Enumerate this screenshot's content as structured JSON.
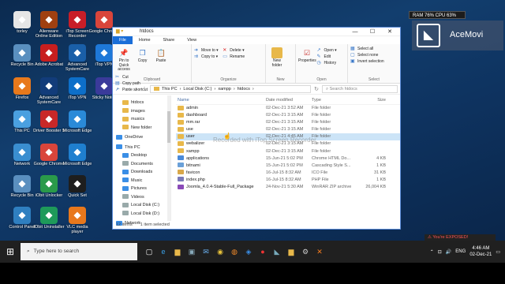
{
  "desktop": {
    "icons": [
      {
        "label": "torley",
        "icon": "user-avatar-icon",
        "color": "#e6e6e6"
      },
      {
        "label": "Alienware Online Edition",
        "icon": "alienware-icon",
        "color": "#a04010"
      },
      {
        "label": "iTop Screen Recorder",
        "icon": "screen-recorder-icon",
        "color": "#c81e28"
      },
      {
        "label": "Google Chrome",
        "icon": "chrome-icon",
        "color": "#d9453b"
      },
      {
        "label": "Recycle Bin",
        "icon": "recycle-bin-icon",
        "color": "#5a8fbf"
      },
      {
        "label": "Adobe Acrobat",
        "icon": "acrobat-icon",
        "color": "#c81e1e"
      },
      {
        "label": "Advanced SystemCare",
        "icon": "systemcare-icon",
        "color": "#1a5fa8"
      },
      {
        "label": "iTop VPN",
        "icon": "vpn-icon",
        "color": "#1e78d8"
      },
      {
        "label": "Firefox",
        "icon": "firefox-icon",
        "color": "#e8791c"
      },
      {
        "label": "Advanced SystemCare",
        "icon": "systemcare-icon",
        "color": "#123c7a"
      },
      {
        "label": "iTop VPN",
        "icon": "vpn-icon",
        "color": "#0d6fc9"
      },
      {
        "label": "Sticky Notes",
        "icon": "sticky-notes-icon",
        "color": "#3a3a9a"
      },
      {
        "label": "This PC",
        "icon": "this-pc-icon",
        "color": "#4aa0e0"
      },
      {
        "label": "Driver Booster 9",
        "icon": "driver-booster-icon",
        "color": "#c82828"
      },
      {
        "label": "Microsoft Edge",
        "icon": "edge-icon",
        "color": "#2a8ad8"
      },
      {
        "label": "Network",
        "icon": "network-icon",
        "color": "#3a8ed0"
      },
      {
        "label": "Google Chrome",
        "icon": "chrome-icon",
        "color": "#d9453b"
      },
      {
        "label": "Microsoft Edge",
        "icon": "edge-icon",
        "color": "#1f7fcf"
      },
      {
        "label": "Recycle Bin",
        "icon": "recycle-bin-icon",
        "color": "#5a8fbf"
      },
      {
        "label": "iObit Unlocker",
        "icon": "unlocker-icon",
        "color": "#2a9a4a"
      },
      {
        "label": "Quick Set",
        "icon": "quick-set-icon",
        "color": "#1e1e1e"
      },
      {
        "label": "Control Panel",
        "icon": "control-panel-icon",
        "color": "#2f7fc0"
      },
      {
        "label": "IObit Uninstaller",
        "icon": "uninstaller-icon",
        "color": "#1e9a5a"
      },
      {
        "label": "VLC media player",
        "icon": "vlc-icon",
        "color": "#e8781c"
      }
    ],
    "perf": "RAM 76%   CPU 63%",
    "acemovi": "AceMovi",
    "exposed": "You're EXPOSED!",
    "watermark": "Recorded with iTop Screen Recorder"
  },
  "explorer": {
    "title": "htdocs",
    "tabs": [
      "File",
      "Home",
      "Share",
      "View"
    ],
    "ribbon": {
      "clipboard": {
        "pin": "Pin to Quick access",
        "copy": "Copy",
        "paste": "Paste",
        "cut": "Cut",
        "copy_path": "Copy path",
        "paste_shortcut": "Paste shortcut",
        "name": "Clipboard"
      },
      "organize": {
        "move_to": "Move to",
        "copy_to": "Copy to",
        "delete": "Delete",
        "rename": "Rename",
        "name": "Organize"
      },
      "new": {
        "new_folder": "New folder",
        "name": "New"
      },
      "open": {
        "properties": "Properties",
        "open": "Open",
        "edit": "Edit",
        "history": "History",
        "name": "Open"
      },
      "select": {
        "select_all": "Select all",
        "select_none": "Select none",
        "invert": "Invert selection",
        "name": "Select"
      }
    },
    "address": {
      "crumbs": [
        "This PC",
        "Local Disk (C:)",
        "xampp",
        "htdocs"
      ],
      "search_placeholder": "Search htdocs"
    },
    "nav_pane": [
      {
        "label": "htdocs",
        "icon": "folder-icon",
        "indent": 1
      },
      {
        "label": "images",
        "icon": "folder-icon",
        "indent": 1
      },
      {
        "label": "musics",
        "icon": "folder-icon",
        "indent": 1
      },
      {
        "label": "New folder",
        "icon": "folder-icon",
        "indent": 1
      },
      {
        "label": "OneDrive",
        "icon": "onedrive-icon",
        "indent": 0
      },
      {
        "label": "This PC",
        "icon": "this-pc-icon",
        "indent": 0
      },
      {
        "label": "Desktop",
        "icon": "desktop-icon",
        "indent": 1
      },
      {
        "label": "Documents",
        "icon": "documents-icon",
        "indent": 1
      },
      {
        "label": "Downloads",
        "icon": "downloads-icon",
        "indent": 1
      },
      {
        "label": "Music",
        "icon": "music-icon",
        "indent": 1
      },
      {
        "label": "Pictures",
        "icon": "pictures-icon",
        "indent": 1
      },
      {
        "label": "Videos",
        "icon": "videos-icon",
        "indent": 1
      },
      {
        "label": "Local Disk (C:)",
        "icon": "drive-icon",
        "indent": 1
      },
      {
        "label": "Local Disk (D:)",
        "icon": "drive-icon",
        "indent": 1
      },
      {
        "label": "Network",
        "icon": "network-icon",
        "indent": 0
      }
    ],
    "columns": [
      "Name",
      "Date modified",
      "Type",
      "Size"
    ],
    "files": [
      {
        "name": "admin",
        "date": "02-Dec-21 3:52 AM",
        "type": "File folder",
        "size": "",
        "kind": "folder"
      },
      {
        "name": "dashboard",
        "date": "02-Dec-21 3:15 AM",
        "type": "File folder",
        "size": "",
        "kind": "folder"
      },
      {
        "name": "mm.rar",
        "date": "02-Dec-21 3:15 AM",
        "type": "File folder",
        "size": "",
        "kind": "folder"
      },
      {
        "name": "use",
        "date": "02-Dec-21 3:15 AM",
        "type": "File folder",
        "size": "",
        "kind": "folder"
      },
      {
        "name": "user",
        "date": "02-Dec-21 4:45 AM",
        "type": "File folder",
        "size": "",
        "kind": "folder",
        "selected": true
      },
      {
        "name": "webalizer",
        "date": "02-Dec-21 3:15 AM",
        "type": "File folder",
        "size": "",
        "kind": "folder"
      },
      {
        "name": "xampp",
        "date": "02-Dec-21 3:15 AM",
        "type": "File folder",
        "size": "",
        "kind": "folder"
      },
      {
        "name": "applications",
        "date": "15-Jun-21 5:02 PM",
        "type": "Chrome HTML Do...",
        "size": "4 KB",
        "kind": "html"
      },
      {
        "name": "bitnami",
        "date": "15-Jun-21 5:02 PM",
        "type": "Cascading Style S...",
        "size": "1 KB",
        "kind": "css"
      },
      {
        "name": "favicon",
        "date": "16-Jul-15 8:32 AM",
        "type": "ICO File",
        "size": "31 KB",
        "kind": "ico"
      },
      {
        "name": "index.php",
        "date": "16-Jul-15 8:32 AM",
        "type": "PHP File",
        "size": "1 KB",
        "kind": "php"
      },
      {
        "name": "Joomla_4.0.4-Stable-Full_Package",
        "date": "24-Nov-21 5:30 AM",
        "type": "WinRAR ZIP archive",
        "size": "26,004 KB",
        "kind": "zip"
      }
    ],
    "status": {
      "count": "12 items",
      "selected": "1 item selected"
    }
  },
  "taskbar": {
    "search_placeholder": "Type here to search",
    "apps": [
      "task-view-icon",
      "edge-icon",
      "file-explorer-icon",
      "store-icon",
      "mail-icon",
      "chrome-icon",
      "firefox-icon",
      "vpn-icon",
      "recorder-icon",
      "acemovi-icon",
      "folder-icon",
      "settings-icon",
      "xampp-icon"
    ],
    "lang": "ENG",
    "time": "4:46 AM",
    "date": "02-Dec-21"
  }
}
